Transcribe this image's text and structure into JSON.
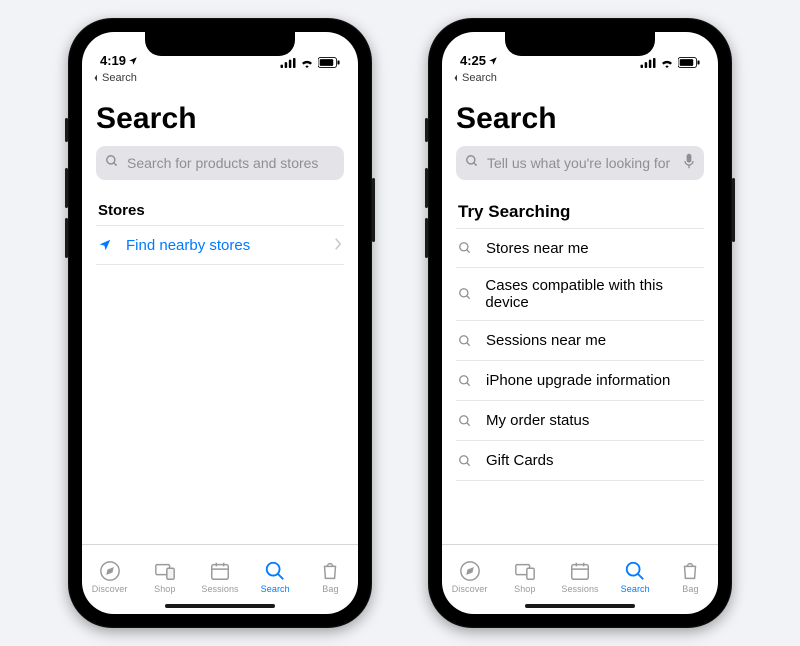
{
  "phones": {
    "left": {
      "statusbar": {
        "time": "4:19",
        "locationArrow": true
      },
      "breadcrumb": "Search",
      "title": "Search",
      "search": {
        "placeholder": "Search for products and stores",
        "showMic": false
      },
      "section": {
        "heading": "Stores"
      },
      "storesLink": {
        "label": "Find nearby stores"
      }
    },
    "right": {
      "statusbar": {
        "time": "4:25",
        "locationArrow": true
      },
      "breadcrumb": "Search",
      "title": "Search",
      "search": {
        "placeholder": "Tell us what you're looking for",
        "showMic": true
      },
      "section": {
        "heading": "Try Searching"
      },
      "suggestions": [
        {
          "label": "Stores near me"
        },
        {
          "label": "Cases compatible with this device"
        },
        {
          "label": "Sessions near me"
        },
        {
          "label": "iPhone upgrade information"
        },
        {
          "label": "My order status"
        },
        {
          "label": "Gift Cards"
        }
      ]
    }
  },
  "tabs": [
    {
      "label": "Discover",
      "icon": "compass"
    },
    {
      "label": "Shop",
      "icon": "devices"
    },
    {
      "label": "Sessions",
      "icon": "calendar"
    },
    {
      "label": "Search",
      "icon": "search",
      "active": true
    },
    {
      "label": "Bag",
      "icon": "bag"
    }
  ]
}
